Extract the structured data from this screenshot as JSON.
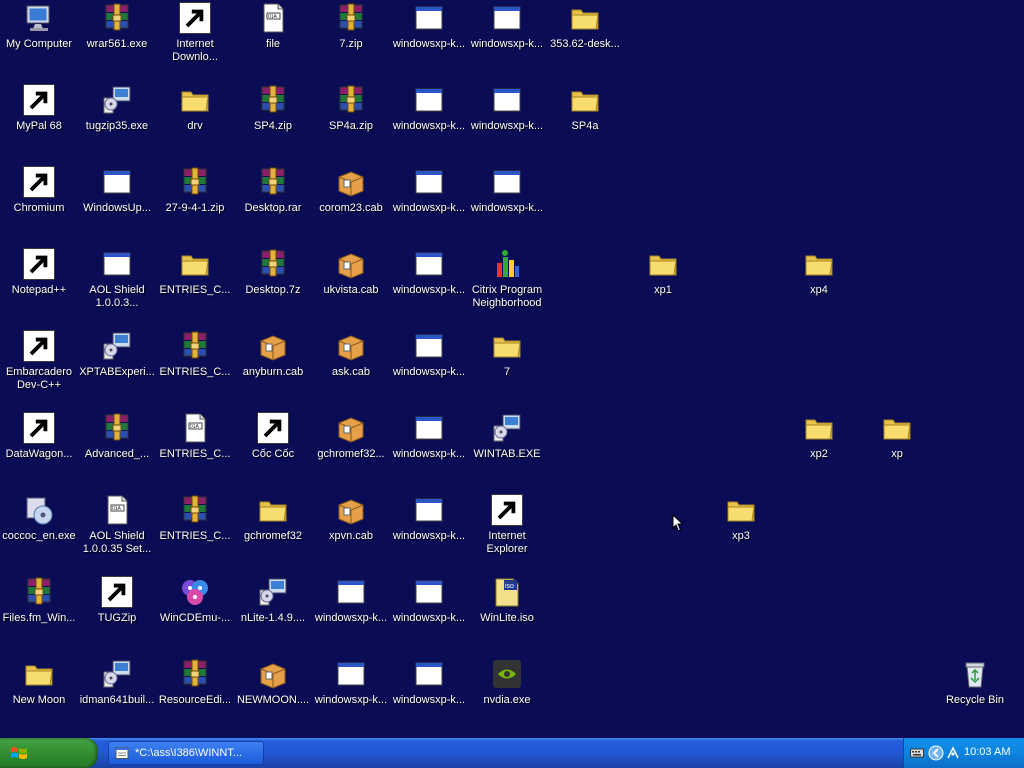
{
  "desktop": {
    "icons": [
      {
        "label": "My Computer",
        "icon": "computer-icon"
      },
      {
        "label": "wrar561.exe",
        "icon": "winrar-icon"
      },
      {
        "label": "Internet Downlo...",
        "icon": "idm-icon"
      },
      {
        "label": "file",
        "icon": "text-document-icon"
      },
      {
        "label": "7.zip",
        "icon": "winrar-icon"
      },
      {
        "label": "windowsxp-k...",
        "icon": "app-window-icon"
      },
      {
        "label": "windowsxp-k...",
        "icon": "app-window-icon"
      },
      {
        "label": "353.62-desk...",
        "icon": "folder-icon"
      },
      {
        "label": "MyPal 68",
        "icon": "mypal-raccoon-icon"
      },
      {
        "label": "tugzip35.exe",
        "icon": "installer-icon"
      },
      {
        "label": "drv",
        "icon": "folder-icon"
      },
      {
        "label": "SP4.zip",
        "icon": "winrar-icon"
      },
      {
        "label": "SP4a.zip",
        "icon": "winrar-icon"
      },
      {
        "label": "windowsxp-k...",
        "icon": "app-window-icon"
      },
      {
        "label": "windowsxp-k...",
        "icon": "app-window-icon"
      },
      {
        "label": "SP4a",
        "icon": "folder-icon"
      },
      {
        "label": "Chromium",
        "icon": "chromium-icon"
      },
      {
        "label": "WindowsUp...",
        "icon": "app-window-icon"
      },
      {
        "label": "27-9-4-1.zip",
        "icon": "winrar-icon"
      },
      {
        "label": "Desktop.rar",
        "icon": "winrar-icon"
      },
      {
        "label": "corom23.cab",
        "icon": "cab-box-icon"
      },
      {
        "label": "windowsxp-k...",
        "icon": "app-window-icon"
      },
      {
        "label": "windowsxp-k...",
        "icon": "app-window-icon"
      },
      {
        "label": "Notepad++",
        "icon": "notepadpp-icon"
      },
      {
        "label": "AOL Shield 1.0.0.3...",
        "icon": "app-window-icon"
      },
      {
        "label": "ENTRIES_C...",
        "icon": "folder-icon"
      },
      {
        "label": "Desktop.7z",
        "icon": "winrar-icon"
      },
      {
        "label": "ukvista.cab",
        "icon": "cab-box-icon"
      },
      {
        "label": "windowsxp-k...",
        "icon": "app-window-icon"
      },
      {
        "label": "Citrix Program Neighborhood",
        "icon": "citrix-icon"
      },
      {
        "label": "xp1",
        "icon": "folder-icon"
      },
      {
        "label": "xp4",
        "icon": "folder-icon"
      },
      {
        "label": "Embarcadero Dev-C++",
        "icon": "devcpp-icon"
      },
      {
        "label": "XPTABExperi...",
        "icon": "installer-icon"
      },
      {
        "label": "ENTRIES_C...",
        "icon": "winrar-icon"
      },
      {
        "label": "anyburn.cab",
        "icon": "cab-box-icon"
      },
      {
        "label": "ask.cab",
        "icon": "cab-box-icon"
      },
      {
        "label": "windowsxp-k...",
        "icon": "app-window-icon"
      },
      {
        "label": "7",
        "icon": "folder-icon"
      },
      {
        "label": "DataWagon...",
        "icon": "datawagon-icon"
      },
      {
        "label": "Advanced_...",
        "icon": "winrar-icon"
      },
      {
        "label": "ENTRIES_C...",
        "icon": "text-document-icon"
      },
      {
        "label": "Cốc Cốc",
        "icon": "coccoc-icon"
      },
      {
        "label": "gchromef32...",
        "icon": "cab-box-icon"
      },
      {
        "label": "windowsxp-k...",
        "icon": "app-window-icon"
      },
      {
        "label": "WINTAB.EXE",
        "icon": "installer-icon"
      },
      {
        "label": "xp2",
        "icon": "folder-icon"
      },
      {
        "label": "xp",
        "icon": "folder-icon"
      },
      {
        "label": "coccoc_en.exe",
        "icon": "setup-cd-icon"
      },
      {
        "label": "AOL Shield 1.0.0.35 Set...",
        "icon": "text-document-icon"
      },
      {
        "label": "ENTRIES_C...",
        "icon": "winrar-icon"
      },
      {
        "label": "gchromef32",
        "icon": "folder-icon"
      },
      {
        "label": "xpvn.cab",
        "icon": "cab-box-icon"
      },
      {
        "label": "windowsxp-k...",
        "icon": "app-window-icon"
      },
      {
        "label": "Internet Explorer",
        "icon": "internet-explorer-icon"
      },
      {
        "label": "xp3",
        "icon": "folder-icon"
      },
      {
        "label": "Files.fm_Win...",
        "icon": "winrar-icon"
      },
      {
        "label": "TUGZip",
        "icon": "tugzip-box-icon"
      },
      {
        "label": "WinCDEmu-...",
        "icon": "wincdemu-icon"
      },
      {
        "label": "nLite-1.4.9....",
        "icon": "installer-icon"
      },
      {
        "label": "windowsxp-k...",
        "icon": "app-window-icon"
      },
      {
        "label": "windowsxp-k...",
        "icon": "app-window-icon"
      },
      {
        "label": "WinLite.iso",
        "icon": "iso-icon"
      },
      {
        "label": "New Moon",
        "icon": "folder-icon"
      },
      {
        "label": "idman641buil...",
        "icon": "installer-icon"
      },
      {
        "label": "ResourceEdi...",
        "icon": "winrar-icon"
      },
      {
        "label": "NEWMOON....",
        "icon": "cab-box-icon"
      },
      {
        "label": "windowsxp-k...",
        "icon": "app-window-icon"
      },
      {
        "label": "windowsxp-k...",
        "icon": "app-window-icon"
      },
      {
        "label": "nvdia.exe",
        "icon": "nvidia-icon"
      },
      {
        "label": "Recycle Bin",
        "icon": "recycle-bin-icon"
      }
    ]
  },
  "taskbar": {
    "start_label": "",
    "task_label": "*C:\\ass\\I386\\WINNT...",
    "clock": "10:03 AM"
  },
  "colors": {
    "desktop_bg": "#0a0c56",
    "taskbar_blue": "#245edb",
    "start_green": "#3c9b3c",
    "tray_blue": "#0f84e0"
  }
}
